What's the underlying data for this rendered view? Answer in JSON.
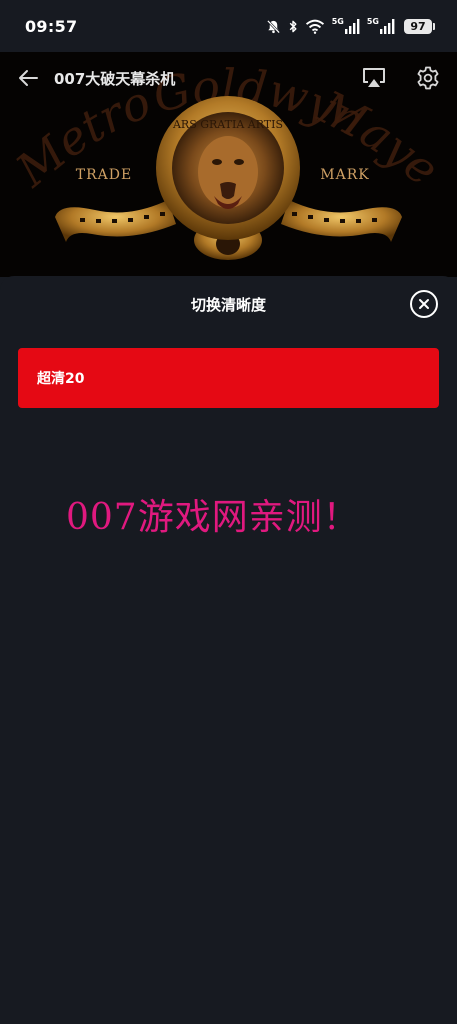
{
  "status_bar": {
    "time": "09:57",
    "icons": [
      "bell-muted-icon",
      "bluetooth-icon",
      "wifi-icon",
      "signal-icon",
      "signal-icon"
    ],
    "network_labels": [
      "5G",
      "5G"
    ],
    "battery": "97"
  },
  "video": {
    "title": "007大破天幕杀机",
    "frame_text": {
      "arc_left": "Metro",
      "arc_center": "Goldwyn",
      "arc_right": "Mayer",
      "trade": "TRADE",
      "mark": "MARK",
      "motto": "ARS GRATIA ARTIS"
    },
    "header_icons": [
      "back-arrow-icon",
      "airplay-icon",
      "gear-icon"
    ]
  },
  "quality_sheet": {
    "title": "切换清晰度",
    "options": [
      {
        "label": "超清20",
        "selected": true
      }
    ],
    "selected_color": "#e50914",
    "watermark_text": "007游戏网亲测！",
    "watermark_color": "#e0197f"
  }
}
